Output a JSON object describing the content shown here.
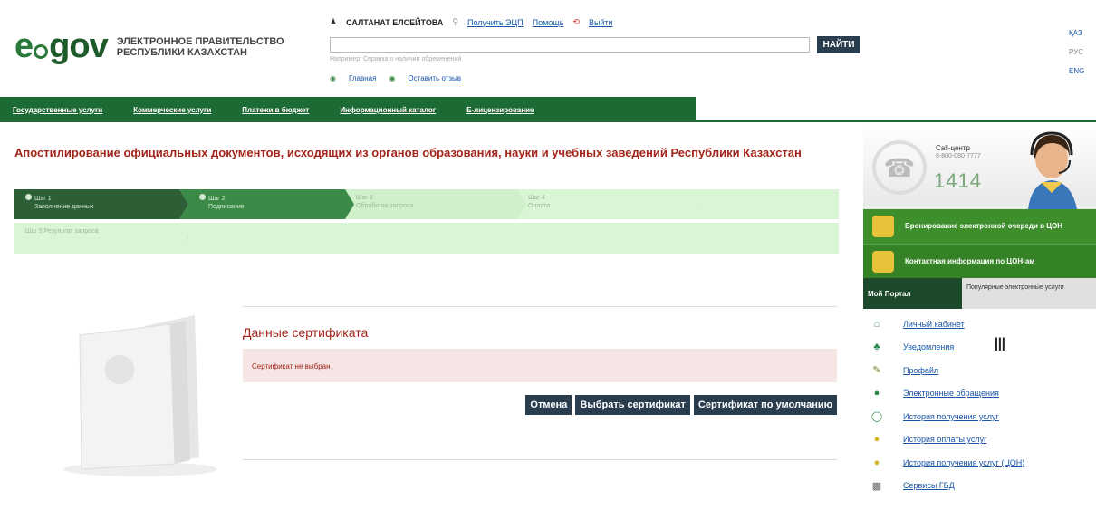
{
  "header": {
    "logo": {
      "e": "e",
      "gov": "gov",
      "line1": "ЭЛЕКТРОННОЕ ПРАВИТЕЛЬСТВО",
      "line2": "РЕСПУБЛИКИ КАЗАХСТАН"
    },
    "user_name": "САЛТАНАТ ЕЛСЕЙТОВА",
    "get_eds": "Получить ЭЦП",
    "help": "Помощь",
    "logout": "Выйти",
    "search": {
      "value": "",
      "button": "НАЙТИ",
      "hint": "Например: Справка о наличии обременений"
    },
    "home": "Главная",
    "feedback": "Оставить отзыв",
    "languages": [
      "ҚАЗ",
      "РУС",
      "ENG"
    ]
  },
  "topnav": [
    "Государственные услуги",
    "Коммерческие услуги",
    "Платежи в бюджет",
    "Информационный каталог",
    "Е-лицензирование"
  ],
  "page": {
    "title": "Апостилирование официальных документов, исходящих из органов образования, науки и учебных заведений Республики Казахстан"
  },
  "steps": [
    {
      "n": "Шаг 1",
      "label": "Заполнение данных"
    },
    {
      "n": "Шаг 2",
      "label": "Подписание"
    },
    {
      "n": "Шаг 3",
      "label": "Обработка запроса"
    },
    {
      "n": "Шаг 4",
      "label": "Оплата"
    },
    {
      "n": "Шаг 5",
      "label": "Результат запроса"
    }
  ],
  "certificate": {
    "title": "Данные сертификата",
    "status": "Сертификат не выбран",
    "buttons": {
      "cancel": "Отмена",
      "choose": "Выбрать сертификат",
      "default": "Сертификат по умолчанию"
    }
  },
  "sidebar": {
    "call_center": {
      "label": "Call-центр",
      "phone": "8-800-080-7777",
      "short": "1414"
    },
    "banners": [
      "Бронирование электронной очереди в ЦОН",
      "Контактная информация по ЦОН-ам"
    ],
    "tabs": {
      "my_portal": "Мой Портал",
      "popular": "Популярные электронные услуги"
    },
    "menu": [
      "Личный кабинет",
      "Уведомления",
      "Профайл",
      "Электронные обращения",
      "История получения услуг",
      "История оплаты услуг",
      "История получения услуг (ЦОН)",
      "Сервисы ГБД"
    ]
  },
  "colors": {
    "accent_green": "#1d6b34",
    "title_red": "#a3241a",
    "button_dark": "#2a3d4f"
  }
}
